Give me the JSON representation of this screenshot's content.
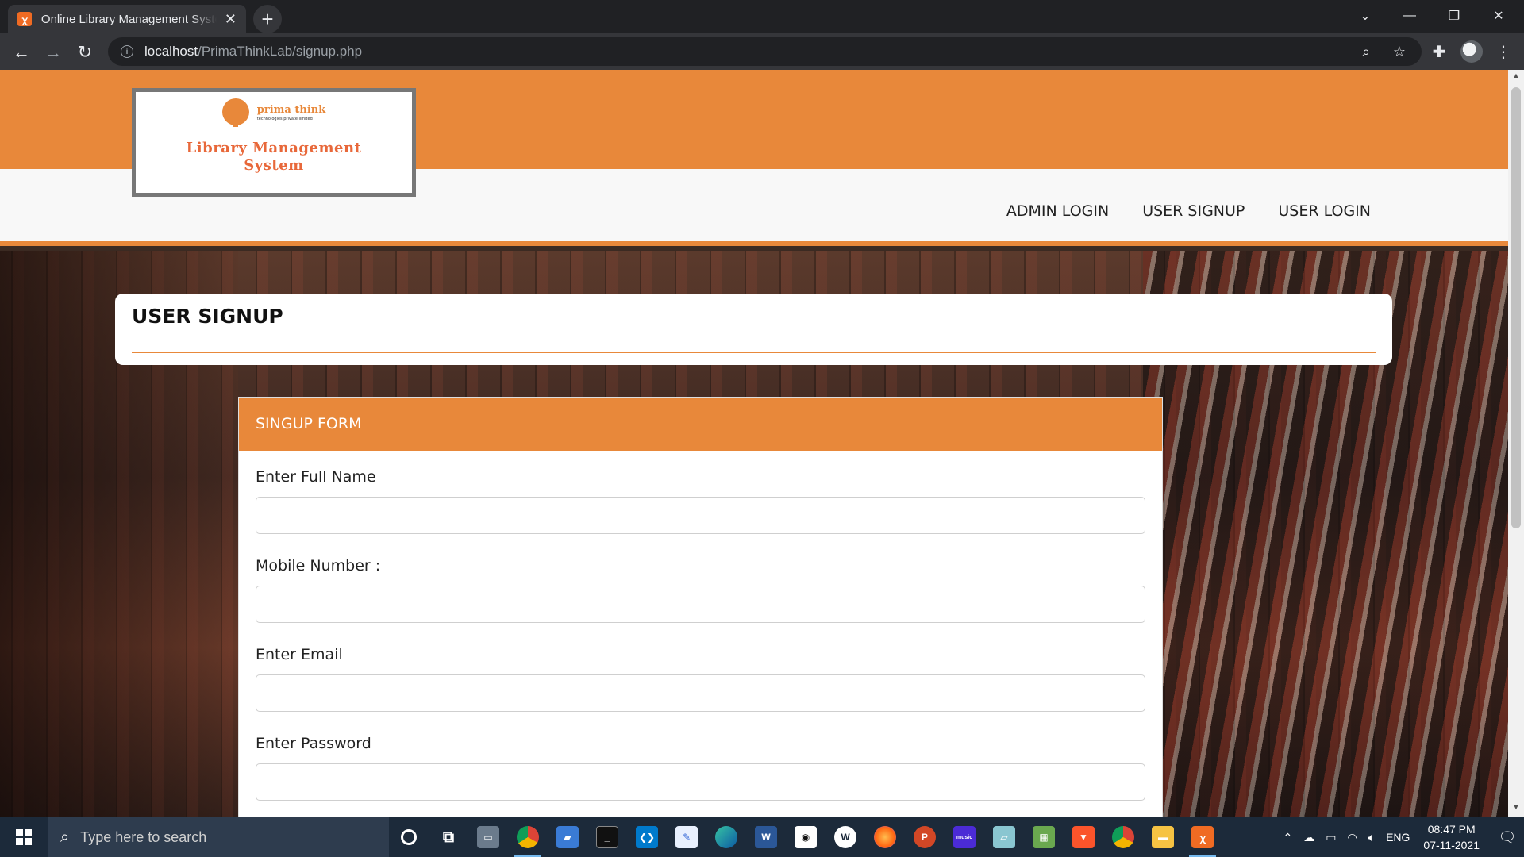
{
  "browser": {
    "tab_title": "Online Library Management System",
    "tab_favicon": "xampp-icon",
    "url_host": "localhost",
    "url_path": "/PrimaThinkLab/signup.php"
  },
  "site": {
    "logo_brand": "prima think",
    "logo_brand_sub": "technologies private limited",
    "logo_title_line1": "Library Management",
    "logo_title_line2": "System",
    "nav": [
      {
        "label": "ADMIN LOGIN"
      },
      {
        "label": "USER SIGNUP"
      },
      {
        "label": "USER LOGIN"
      }
    ],
    "accent_color": "#e8883a"
  },
  "page": {
    "heading": "USER SIGNUP",
    "form_title": "SINGUP FORM",
    "fields": [
      {
        "label": "Enter Full Name",
        "value": "",
        "placeholder": ""
      },
      {
        "label": "Mobile Number :",
        "value": "",
        "placeholder": ""
      },
      {
        "label": "Enter Email",
        "value": "",
        "placeholder": ""
      },
      {
        "label": "Enter Password",
        "value": "",
        "placeholder": ""
      }
    ]
  },
  "taskbar": {
    "search_placeholder": "Type here to search",
    "language": "ENG",
    "time": "08:47 PM",
    "date": "07-11-2021"
  }
}
